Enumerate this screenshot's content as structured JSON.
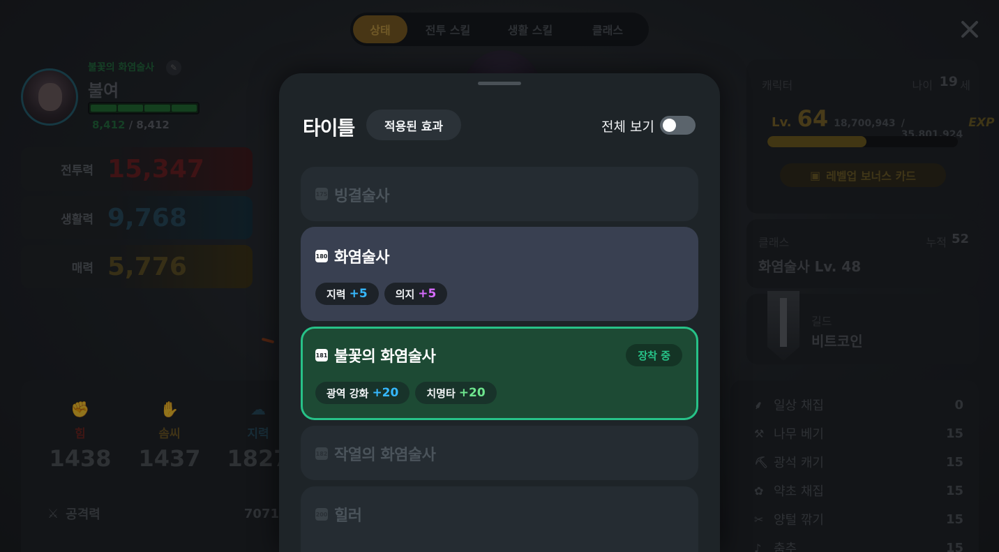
{
  "tabs": [
    {
      "label": "상태"
    },
    {
      "label": "전투 스킬"
    },
    {
      "label": "생활 스킬"
    },
    {
      "label": "클래스"
    }
  ],
  "profile": {
    "title": "불꽃의 화염술사",
    "name": "불여",
    "hp_current": "8,412",
    "hp_max": "/ 8,412",
    "hp_fraction": 1.0
  },
  "stats": [
    {
      "label": "전투력",
      "value": "15,347"
    },
    {
      "label": "생활력",
      "value": "9,768"
    },
    {
      "label": "매력",
      "value": "5,776"
    }
  ],
  "attributes": [
    {
      "name": "힘",
      "value": "1438",
      "icon": "fist-icon"
    },
    {
      "name": "솜씨",
      "value": "1437",
      "icon": "hand-icon"
    },
    {
      "name": "지력",
      "value": "1827",
      "icon": "brain-icon"
    }
  ],
  "attack": {
    "label": "공격력",
    "value": "7071"
  },
  "character_panel": {
    "label": "캐릭터",
    "age_label": "나이",
    "age_value": "19",
    "age_unit": "세",
    "level_prefix": "Lv.",
    "level": "64",
    "exp_current": "18,700,943",
    "exp_max": "/ 35,801,924",
    "exp_icon": "EXP",
    "exp_fraction": 0.52,
    "bonus_button": "레벨업 보너스 카드"
  },
  "class_panel": {
    "label": "클래스",
    "total_label": "누적",
    "total_value": "52",
    "class_value": "화염술사 Lv. 48"
  },
  "guild_panel": {
    "label": "길드",
    "name": "비트코인"
  },
  "life_skills": [
    {
      "name": "일상 채집",
      "value": "0",
      "icon": "sickle-icon"
    },
    {
      "name": "나무 베기",
      "value": "15",
      "icon": "axe-icon"
    },
    {
      "name": "광석 캐기",
      "value": "15",
      "icon": "pickaxe-icon"
    },
    {
      "name": "약초 채집",
      "value": "15",
      "icon": "herb-icon"
    },
    {
      "name": "양털 깎기",
      "value": "15",
      "icon": "shears-icon"
    },
    {
      "name": "춤추",
      "value": "15",
      "icon": "dance-icon"
    }
  ],
  "modal": {
    "title": "타이틀",
    "effects_button": "적용된 효과",
    "view_all_label": "전체 보기",
    "view_all_on": false,
    "cards": [
      {
        "badge": "175",
        "name": "빙결술사"
      },
      {
        "badge": "180",
        "name": "화염술사",
        "bonuses": [
          {
            "stat": "지력",
            "amount": "+5"
          },
          {
            "stat": "의지",
            "amount": "+5"
          }
        ]
      },
      {
        "badge": "181",
        "name": "불꽃의 화염술사",
        "status": "장착 중",
        "bonuses": [
          {
            "stat": "광역 강화",
            "amount": "+20"
          },
          {
            "stat": "치명타",
            "amount": "+20"
          }
        ]
      },
      {
        "badge": "182",
        "name": "작열의 화염술사"
      },
      {
        "badge": "200",
        "name": "힐러"
      }
    ]
  },
  "colors": {
    "accent_green": "#27c288",
    "bonus_blue": "#36b8ff",
    "bonus_purple": "#d76cff",
    "bonus_green": "#6ee68e",
    "active_tab": "#7a5a1c"
  }
}
